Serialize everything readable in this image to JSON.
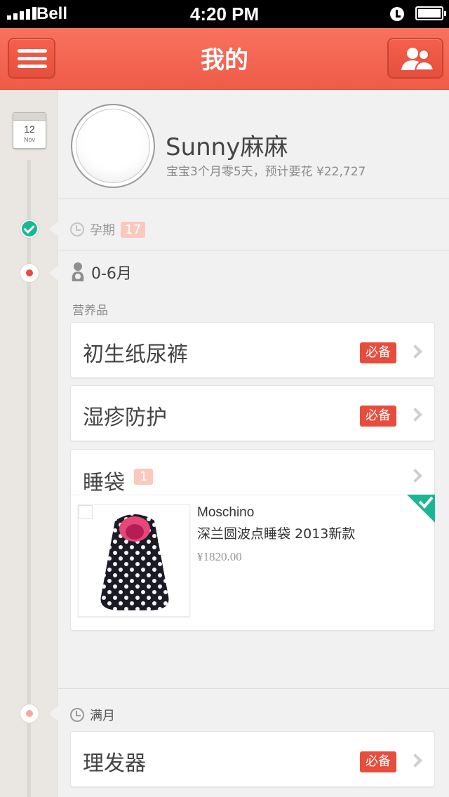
{
  "status_bar": {
    "carrier": "Bell",
    "time": "4:20 PM"
  },
  "nav": {
    "title": "我的",
    "menu_icon": "hamburger-icon",
    "friends_icon": "friends-icon"
  },
  "calendar": {
    "day": "12",
    "month": "Nov"
  },
  "profile": {
    "name": "Sunny麻麻",
    "subtitle": "宝宝3个月零5天，预计要花 ¥22,727"
  },
  "stages": {
    "pregnancy": {
      "label": "孕期",
      "count": "17"
    },
    "infant": {
      "label": "0-6月",
      "category": "营养品"
    },
    "first_month": {
      "label": "满月"
    }
  },
  "items": [
    {
      "title": "初生纸尿裤",
      "tag": "必备"
    },
    {
      "title": "湿疹防护",
      "tag": "必备"
    },
    {
      "title": "睡袋",
      "count": "1"
    },
    {
      "title": "理发器",
      "tag": "必备"
    }
  ],
  "product": {
    "brand": "Moschino",
    "description": "深兰圆波点睡袋 2013新款",
    "price": "¥1820.00"
  },
  "colors": {
    "accent": "#ef5b47",
    "done": "#1cb694",
    "required": "#e74c3c"
  }
}
